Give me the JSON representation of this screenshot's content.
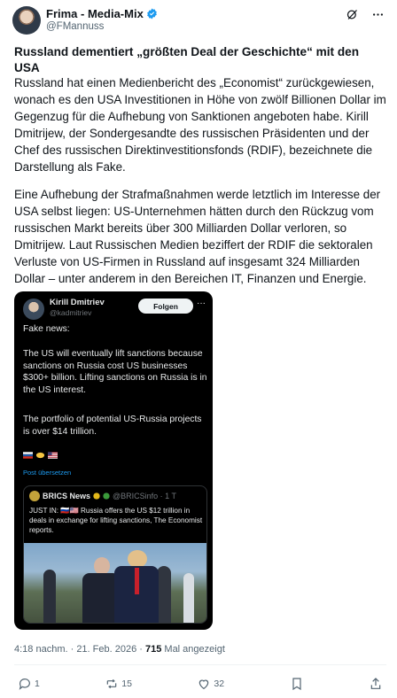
{
  "author": {
    "name": "Frima - Media-Mix",
    "handle": "@FMannuss"
  },
  "post": {
    "title": "Russland dementiert „größten Deal der Geschichte“ mit den USA",
    "paragraph1": "Russland hat einen Medienbericht des „Economist“ zurückgewiesen, wonach es den USA Investitionen in Höhe von zwölf Billionen Dollar im Gegenzug für die Aufhebung von Sanktionen angeboten habe. Kirill Dmitrijew, der Sondergesandte des russischen Präsidenten und der Chef des russischen Direktinvestitionsfonds (RDIF), bezeichnete die Darstellung als Fake.",
    "paragraph2": "Eine Aufhebung der Strafmaßnahmen werde letztlich im Interesse der USA selbst liegen: US-Unternehmen hätten durch den Rückzug vom russischen Markt bereits über 300 Milliarden Dollar verloren, so Dmitrijew. Laut Russischen Medien beziffert der RDIF die sektoralen Verluste von US-Firmen in Russland auf insgesamt 324 Milliarden Dollar – unter anderem in den Bereichen IT, Finanzen und Energie."
  },
  "embed": {
    "name": "Kirill Dmitriev",
    "handle": "@kadmitriev",
    "follow_label": "Folgen",
    "more": "···",
    "text1": "Fake news:",
    "text2": "The US will eventually lift sanctions because sanctions on Russia cost US businesses $300+ billion. Lifting sanctions on Russia is in the US interest.",
    "text3": "The portfolio of potential US-Russia projects is over $14 trillion.",
    "translate_label": "Post übersetzen",
    "quote": {
      "name": "BRICS News",
      "handle": "@BRICSinfo · 1 T",
      "text": "JUST IN: 🇷🇺🇺🇸 Russia offers the US $12 trillion in deals in exchange for lifting sanctions, The Economist reports."
    }
  },
  "meta": {
    "time": "4:18 nachm. · 21. Feb. 2026 ·",
    "views": "715",
    "views_label": "Mal angezeigt"
  },
  "actions": {
    "replies": "1",
    "reposts": "15",
    "likes": "32"
  },
  "colors": {
    "verified": "#1d9bf0",
    "text": "#0f1419",
    "muted": "#536471"
  }
}
